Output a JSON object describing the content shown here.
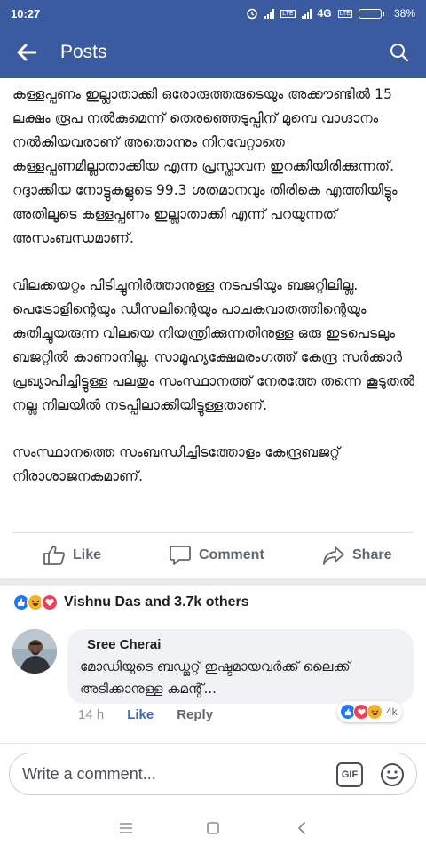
{
  "status_bar": {
    "time": "10:27",
    "network": "4G",
    "battery_percent": 38,
    "battery_label": "38%"
  },
  "header": {
    "title": "Posts",
    "back_icon": "arrow-left-icon",
    "search_icon": "search-icon"
  },
  "post": {
    "paragraphs": [
      "കള്ളപ്പണം ഇല്ലാതാക്കി ഒരോരുത്തരുടെയും അക്കൗണ്ടിൽ 15 ലക്ഷം രൂപ നൽകുമെന്ന് തെരഞ്ഞെടുപ്പിന് മുമ്പെ വാഗ്ദാനം നൽകിയവരാണ് അതൊന്നും നിറവേറ്റാതെ കള്ളപ്പണമില്ലാതാക്കിയ എന്ന പ്രസ്താവന ഇറക്കിയിരിക്കുന്നത്. റദ്ദാക്കിയ നോട്ടുകളുടെ 99.3 ശതമാനവും തിരികെ എത്തിയിട്ടും അതിലൂടെ കള്ളപ്പണം ഇല്ലാതാക്കി  എന്ന് പറയുന്നത് അസംബന്ധമാണ്.",
      "വിലക്കയറ്റം പിടിച്ചുനിർത്താനുള്ള നടപടിയും ബജറ്റിലില്ല. പെട്രോളിന്റെയും ഡീസലിന്റെയും പാചകവാതത്തിന്റെയും കുതിച്ചുയരുന്ന വിലയെ നിയന്ത്രിക്കുന്നതിനുള്ള ഒരു ഇടപെടലും ബജറ്റിൽ കാണാനില്ല. സാമൂഹ്യക്ഷേമരംഗത്ത് കേന്ദ്ര സർക്കാർ പ്രഖ്യാപിച്ചിട്ടുള്ള പലതും സംസ്ഥാനത്ത് നേരത്തേ തന്നെ കൂടുതൽ നല്ല നിലയിൽ നടപ്പിലാക്കിയിട്ടുള്ളതാണ്.",
      "സംസ്ഥാനത്തെ സംബന്ധിച്ചിടത്തോളം കേന്ദ്രബജറ്റ് നിരാശാജനകമാണ്."
    ]
  },
  "actions": {
    "like": "Like",
    "comment": "Comment",
    "share": "Share"
  },
  "reactions": {
    "icons": [
      "like-icon",
      "haha-icon",
      "love-icon"
    ],
    "summary": "Vishnu Das and 3.7k others"
  },
  "comment": {
    "author": "Sree Cherai",
    "text": "മോഡിയുടെ ബഡ്ജറ്റ് ഇഷ്ടമായവർക്ക് ലൈക്ക് അടിക്കാനുള്ള കമന്റ്...",
    "time": "14 h",
    "like_label": "Like",
    "reply_label": "Reply",
    "reaction_icons": [
      "like-icon",
      "love-icon",
      "haha-icon"
    ],
    "reaction_count": "4k"
  },
  "composer": {
    "placeholder": "Write a comment...",
    "gif_label": "GIF"
  },
  "colors": {
    "brand": "#3b5ba0",
    "link": "#4267b2",
    "like": "#2078f4",
    "love": "#f33e58",
    "haha": "#f7b125"
  }
}
